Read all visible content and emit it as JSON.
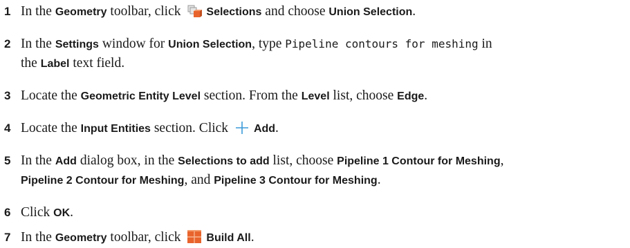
{
  "steps": [
    {
      "num": "1",
      "t1": "In the ",
      "b1": "Geometry",
      "t2": " toolbar, click ",
      "b2": "Selections",
      "t3": " and choose ",
      "b3": "Union Selection",
      "t4": "."
    },
    {
      "num": "2",
      "t1": "In the ",
      "b1": "Settings",
      "t2": " window for ",
      "b2": "Union Selection",
      "t3": ", type ",
      "code": "Pipeline contours for meshing",
      "t4": " in",
      "cont_t1": "the ",
      "cont_b1": "Label",
      "cont_t2": " text field."
    },
    {
      "num": "3",
      "t1": "Locate the ",
      "b1": "Geometric Entity Level",
      "t2": " section. From the ",
      "b2": "Level",
      "t3": " list, choose ",
      "b3": "Edge",
      "t4": "."
    },
    {
      "num": "4",
      "t1": "Locate the ",
      "b1": "Input Entities",
      "t2": " section. Click ",
      "b2": "Add",
      "t3": "."
    },
    {
      "num": "5",
      "t1": "In the ",
      "b1": "Add",
      "t2": " dialog box, in the ",
      "b2": "Selections to add",
      "t3": " list, choose ",
      "b3": "Pipeline 1 Contour for Meshing",
      "t4": ",",
      "cont_b1": "Pipeline 2 Contour for Meshing",
      "cont_t1": ", and ",
      "cont_b2": "Pipeline 3 Contour for Meshing",
      "cont_t2": "."
    },
    {
      "num": "6",
      "t1": "Click ",
      "b1": "OK",
      "t2": "."
    },
    {
      "num": "7",
      "t1": "In the ",
      "b1": "Geometry",
      "t2": " toolbar, click ",
      "b2": "Build All",
      "t3": "."
    }
  ],
  "icons": {
    "selections": "selections-icon",
    "add": "add-plus-icon",
    "build_all": "build-all-icon"
  },
  "colors": {
    "accent": "#e8642c",
    "plus": "#3a9ad9"
  }
}
